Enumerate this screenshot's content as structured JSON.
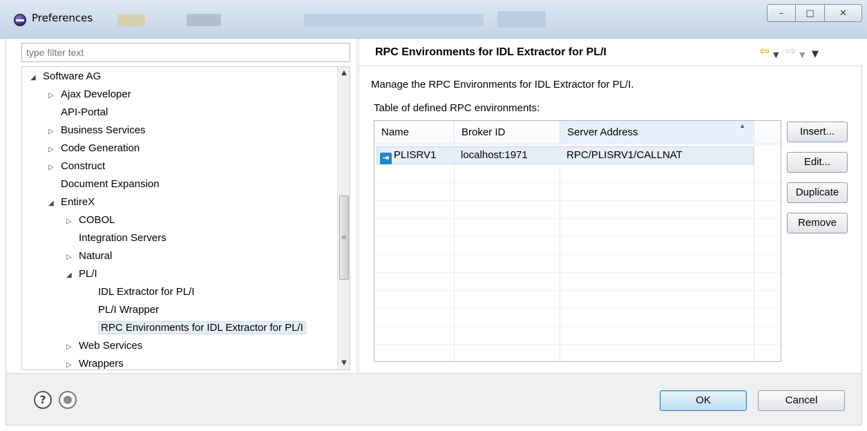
{
  "window": {
    "title": "Preferences",
    "buttons": {
      "minimize": "–",
      "maximize": "□",
      "close": "✕"
    }
  },
  "left": {
    "filter_placeholder": "type filter text",
    "tree": [
      {
        "label": "Software AG",
        "level": 0,
        "twisty": "◢",
        "selected": false
      },
      {
        "label": "Ajax Developer",
        "level": 1,
        "twisty": "▷",
        "selected": false
      },
      {
        "label": "API-Portal",
        "level": 1,
        "twisty": "",
        "selected": false
      },
      {
        "label": "Business Services",
        "level": 1,
        "twisty": "▷",
        "selected": false
      },
      {
        "label": "Code Generation",
        "level": 1,
        "twisty": "▷",
        "selected": false
      },
      {
        "label": "Construct",
        "level": 1,
        "twisty": "▷",
        "selected": false
      },
      {
        "label": "Document Expansion",
        "level": 1,
        "twisty": "",
        "selected": false
      },
      {
        "label": "EntireX",
        "level": 1,
        "twisty": "◢",
        "selected": false
      },
      {
        "label": "COBOL",
        "level": 2,
        "twisty": "▷",
        "selected": false
      },
      {
        "label": "Integration Servers",
        "level": 2,
        "twisty": "",
        "selected": false
      },
      {
        "label": "Natural",
        "level": 2,
        "twisty": "▷",
        "selected": false
      },
      {
        "label": "PL/I",
        "level": 2,
        "twisty": "◢",
        "selected": false
      },
      {
        "label": "IDL Extractor for PL/I",
        "level": 3,
        "twisty": "",
        "selected": false
      },
      {
        "label": "PL/I Wrapper",
        "level": 3,
        "twisty": "",
        "selected": false
      },
      {
        "label": "RPC Environments for IDL Extractor for PL/I",
        "level": 3,
        "twisty": "",
        "selected": true
      },
      {
        "label": "Web Services",
        "level": 2,
        "twisty": "▷",
        "selected": false
      },
      {
        "label": "Wrappers",
        "level": 2,
        "twisty": "▷",
        "selected": false
      }
    ]
  },
  "right": {
    "title": "RPC Environments for IDL Extractor for PL/I",
    "description": "Manage the RPC Environments for IDL Extractor for PL/I.",
    "table_caption": "Table of defined RPC environments:",
    "columns": [
      "Name",
      "Broker ID",
      "Server Address"
    ],
    "rows": [
      {
        "name": "PLISRV1",
        "broker_id": "localhost:1971",
        "server_address": "RPC/PLISRV1/CALLNAT"
      }
    ],
    "buttons": {
      "insert": "Insert...",
      "edit": "Edit...",
      "duplicate": "Duplicate",
      "remove": "Remove"
    }
  },
  "footer": {
    "ok": "OK",
    "cancel": "Cancel"
  }
}
